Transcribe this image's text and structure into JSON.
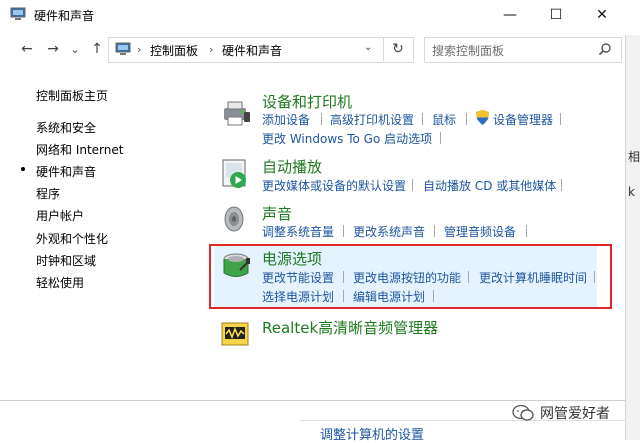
{
  "window": {
    "title": "硬件和声音",
    "min": "—",
    "max": "☐",
    "close": "✕"
  },
  "nav": {
    "back": "←",
    "forward": "→",
    "recent": "⌄",
    "up": "↑",
    "refresh": "↻"
  },
  "address": {
    "crumb1": "控制面板",
    "crumb2": "硬件和声音",
    "sep": "›",
    "search_placeholder": "搜索控制面板"
  },
  "sidebar": {
    "items": [
      {
        "label": "控制面板主页"
      },
      {
        "label": "系统和安全"
      },
      {
        "label": "网络和 Internet"
      },
      {
        "label": "硬件和声音"
      },
      {
        "label": "程序"
      },
      {
        "label": "用户帐户"
      },
      {
        "label": "外观和个性化"
      },
      {
        "label": "时钟和区域"
      },
      {
        "label": "轻松使用"
      }
    ]
  },
  "categories": {
    "devices": {
      "title": "设备和打印机",
      "links": [
        "添加设备",
        "高级打印机设置",
        "鼠标",
        "设备管理器",
        "更改 Windows To Go 启动选项"
      ]
    },
    "autoplay": {
      "title": "自动播放",
      "links": [
        "更改媒体或设备的默认设置",
        "自动播放 CD 或其他媒体"
      ]
    },
    "sound": {
      "title": "声音",
      "links": [
        "调整系统音量",
        "更改系统声音",
        "管理音频设备"
      ]
    },
    "power": {
      "title": "电源选项",
      "links": [
        "更改节能设置",
        "更改电源按钮的功能",
        "更改计算机睡眠时间",
        "选择电源计划",
        "编辑电源计划"
      ]
    },
    "realtek": {
      "title": "Realtek高清晰音频管理器"
    }
  },
  "behind": {
    "right_char": "相",
    "right_char2": "k",
    "bottom_peek": "调整计算机的设置"
  },
  "watermark": {
    "text": "网管爱好者"
  },
  "colors": {
    "link": "#1e56a0",
    "category_title": "#1e7a1e",
    "highlight_border": "#e0262b",
    "highlight_fill": "#e5f3ff"
  }
}
